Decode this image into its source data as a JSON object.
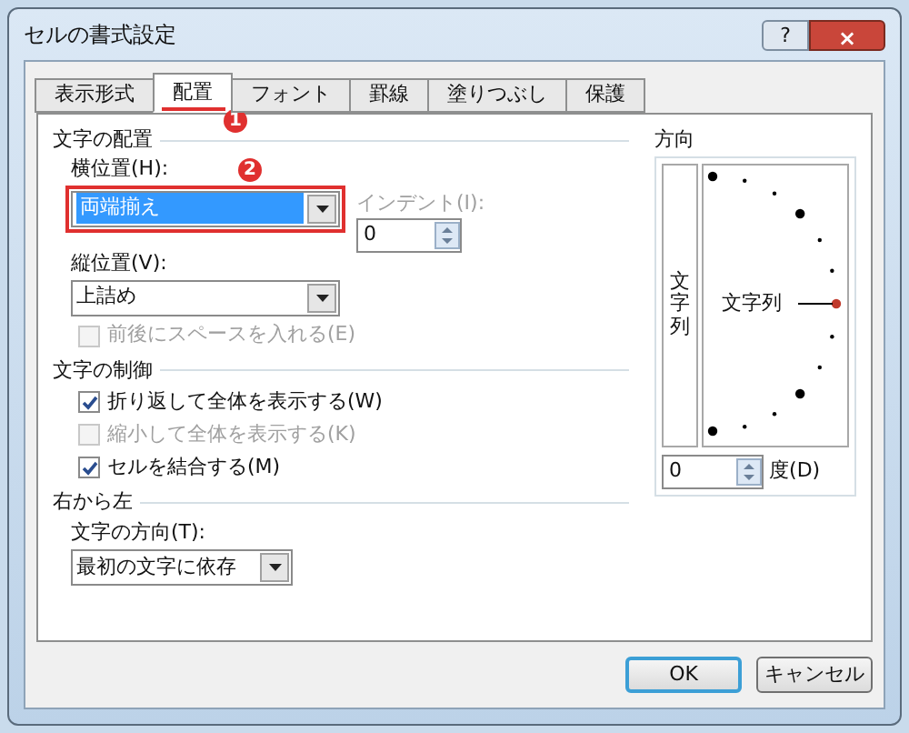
{
  "window": {
    "title": "セルの書式設定",
    "help": "?",
    "close": "×"
  },
  "tabs": [
    {
      "label": "表示形式",
      "selected": false
    },
    {
      "label": "配置",
      "selected": true
    },
    {
      "label": "フォント",
      "selected": false
    },
    {
      "label": "罫線",
      "selected": false
    },
    {
      "label": "塗りつぶし",
      "selected": false
    },
    {
      "label": "保護",
      "selected": false
    }
  ],
  "callouts": [
    "1",
    "2"
  ],
  "alignment": {
    "title": "文字の配置",
    "horizontal_label": "横位置(H):",
    "horizontal_value": "両端揃え",
    "indent_label": "インデント(I):",
    "indent_value": "0",
    "vertical_label": "縦位置(V):",
    "vertical_value": "上詰め",
    "checkboxes": [
      {
        "label": "前後にスペースを入れる(E)",
        "checked": false,
        "disabled": true
      }
    ]
  },
  "control": {
    "title": "文字の制御",
    "checkboxes": [
      {
        "label": "折り返して全体を表示する(W)",
        "checked": true,
        "disabled": false
      },
      {
        "label": "縮小して全体を表示する(K)",
        "checked": false,
        "disabled": true
      },
      {
        "label": "セルを結合する(M)",
        "checked": true,
        "disabled": false
      }
    ]
  },
  "rtl": {
    "title": "右から左",
    "direction_label": "文字の方向(T):",
    "direction_value": "最初の文字に依存"
  },
  "orientation": {
    "title": "方向",
    "vertical_text": "文字列",
    "dial_text": "文字列",
    "degrees_value": "0",
    "degrees_label": "度(D)"
  },
  "buttons": [
    "OK",
    "キャンセル"
  ]
}
